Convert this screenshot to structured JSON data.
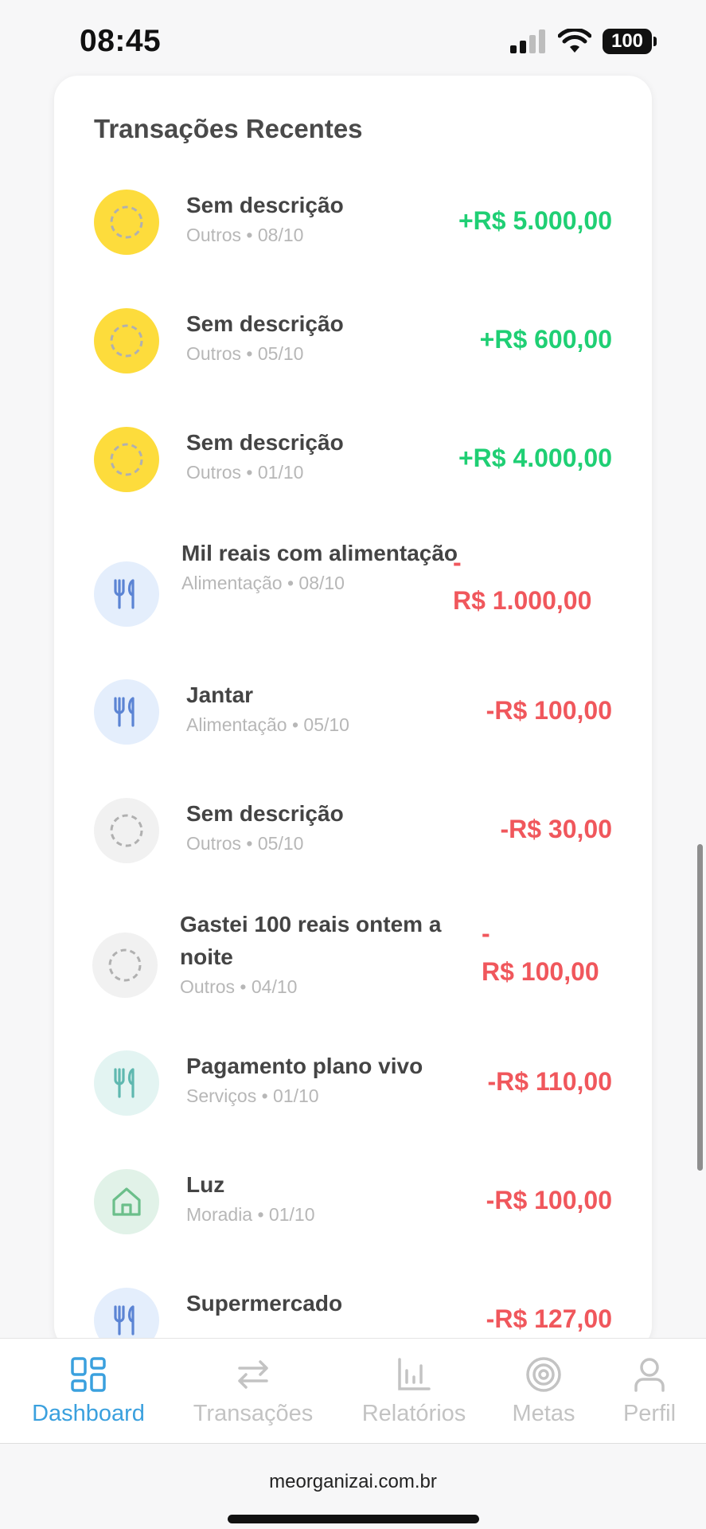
{
  "status_bar": {
    "time": "08:45",
    "battery": "100"
  },
  "card": {
    "title": "Transações Recentes",
    "transactions": [
      {
        "title": "Sem descrição",
        "subtitle": "Outros • 08/10",
        "amount": "+R$ 5.000,00",
        "type": "income",
        "icon": "dashed-circle-icon",
        "icon_bg": "#fddc3c"
      },
      {
        "title": "Sem descrição",
        "subtitle": "Outros • 05/10",
        "amount": "+R$ 600,00",
        "type": "income",
        "icon": "dashed-circle-icon",
        "icon_bg": "#fddc3c"
      },
      {
        "title": "Sem descrição",
        "subtitle": "Outros • 01/10",
        "amount": "+R$ 4.000,00",
        "type": "income",
        "icon": "dashed-circle-icon",
        "icon_bg": "#fddc3c"
      },
      {
        "title": "Mil reais com alimentação",
        "subtitle": "Alimentação • 08/10",
        "amount_sign": "-",
        "amount_value": "R$ 1.000,00",
        "type": "expense",
        "icon": "utensils-icon",
        "icon_bg": "#e4eefc"
      },
      {
        "title": "Jantar",
        "subtitle": "Alimentação • 05/10",
        "amount": "-R$ 100,00",
        "type": "expense",
        "icon": "utensils-icon",
        "icon_bg": "#e4eefc"
      },
      {
        "title": "Sem descrição",
        "subtitle": "Outros • 05/10",
        "amount": "-R$ 30,00",
        "type": "expense",
        "icon": "dashed-circle-icon",
        "icon_bg": "#f1f1f1"
      },
      {
        "title": "Gastei 100 reais ontem a noite",
        "subtitle": "Outros • 04/10",
        "amount_sign": "-",
        "amount_value": "R$ 100,00",
        "type": "expense",
        "icon": "dashed-circle-icon",
        "icon_bg": "#f1f1f1"
      },
      {
        "title": "Pagamento plano vivo",
        "subtitle": "Serviços • 01/10",
        "amount": "-R$ 110,00",
        "type": "expense",
        "icon": "utensils-icon",
        "icon_bg": "#e3f4f2"
      },
      {
        "title": "Luz",
        "subtitle": "Moradia • 01/10",
        "amount": "-R$ 100,00",
        "type": "expense",
        "icon": "house-icon",
        "icon_bg": "#e1f2e8"
      },
      {
        "title": "Supermercado",
        "subtitle": "",
        "amount": "-R$ 127,00",
        "type": "expense",
        "icon": "utensils-icon",
        "icon_bg": "#e4eefc"
      }
    ]
  },
  "tabs": [
    {
      "label": "Dashboard",
      "icon": "grid-icon",
      "active": true
    },
    {
      "label": "Transações",
      "icon": "arrows-swap-icon",
      "active": false
    },
    {
      "label": "Relatórios",
      "icon": "bar-chart-icon",
      "active": false
    },
    {
      "label": "Metas",
      "icon": "target-icon",
      "active": false
    },
    {
      "label": "Perfil",
      "icon": "user-icon",
      "active": false
    }
  ],
  "browser": {
    "url": "meorganizai.com.br"
  },
  "colors": {
    "income": "#1fcf74",
    "expense": "#f0575c",
    "accent": "#3aa0de",
    "inactive": "#c3c3c3"
  }
}
